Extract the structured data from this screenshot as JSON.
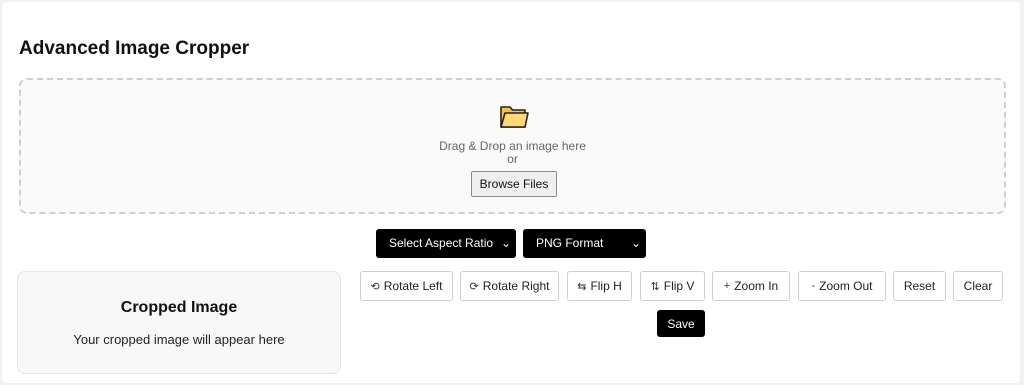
{
  "app": {
    "title": "Advanced Image Cropper"
  },
  "dropzone": {
    "line1": "Drag & Drop an image here",
    "line2": "or",
    "browse_label": "Browse Files",
    "icon": "folder-icon"
  },
  "options": {
    "aspect_ratio": "Select Aspect Ratio",
    "format": "PNG Format"
  },
  "result": {
    "title": "Cropped Image",
    "placeholder": "Your cropped image will appear here"
  },
  "toolbar": {
    "rotate_left": {
      "icon": "⟲",
      "label": "Rotate Left"
    },
    "rotate_right": {
      "icon": "⟳",
      "label": "Rotate Right"
    },
    "flip_h": {
      "icon": "⇆",
      "label": "Flip H"
    },
    "flip_v": {
      "icon": "⇅",
      "label": "Flip V"
    },
    "zoom_in": {
      "icon": "+",
      "label": "Zoom In"
    },
    "zoom_out": {
      "icon": "-",
      "label": "Zoom Out"
    },
    "reset": {
      "label": "Reset"
    },
    "clear": {
      "label": "Clear"
    },
    "save": {
      "label": "Save"
    }
  },
  "colors": {
    "primary": "#000000",
    "folder": "#ffd875"
  }
}
